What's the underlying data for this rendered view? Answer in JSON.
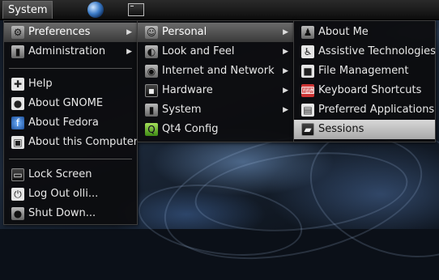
{
  "panel": {
    "menu_label": "System"
  },
  "system_menu": {
    "items": [
      {
        "label": "Preferences",
        "icon": "preferences-icon",
        "submenu": true
      },
      {
        "label": "Administration",
        "icon": "administration-icon",
        "submenu": true
      }
    ],
    "help_items": [
      {
        "label": "Help",
        "icon": "help-icon"
      },
      {
        "label": "About GNOME",
        "icon": "gnome-foot-icon"
      },
      {
        "label": "About Fedora",
        "icon": "fedora-icon"
      },
      {
        "label": "About this Computer",
        "icon": "computer-icon"
      }
    ],
    "session_items": [
      {
        "label": "Lock Screen",
        "icon": "lock-screen-icon"
      },
      {
        "label": "Log Out olli...",
        "icon": "log-out-icon"
      },
      {
        "label": "Shut Down...",
        "icon": "shut-down-icon"
      }
    ]
  },
  "preferences_menu": {
    "items": [
      {
        "label": "Personal",
        "icon": "personal-icon",
        "submenu": true
      },
      {
        "label": "Look and Feel",
        "icon": "look-and-feel-icon",
        "submenu": true
      },
      {
        "label": "Internet and Network",
        "icon": "network-icon",
        "submenu": true
      },
      {
        "label": "Hardware",
        "icon": "hardware-icon",
        "submenu": true
      },
      {
        "label": "System",
        "icon": "system-icon",
        "submenu": true
      },
      {
        "label": "Qt4 Config",
        "icon": "qt4-icon",
        "submenu": false
      }
    ]
  },
  "personal_menu": {
    "items": [
      {
        "label": "About Me",
        "icon": "about-me-icon"
      },
      {
        "label": "Assistive Technologies",
        "icon": "accessibility-icon"
      },
      {
        "label": "File Management",
        "icon": "file-management-icon"
      },
      {
        "label": "Keyboard Shortcuts",
        "icon": "keyboard-shortcuts-icon"
      },
      {
        "label": "Preferred Applications",
        "icon": "preferred-applications-icon"
      },
      {
        "label": "Sessions",
        "icon": "sessions-icon"
      }
    ]
  },
  "colors": {
    "menu_bg": "#0c0c0e",
    "highlight": "#6a6a6a",
    "highlight_light": "#d8d8d8"
  }
}
